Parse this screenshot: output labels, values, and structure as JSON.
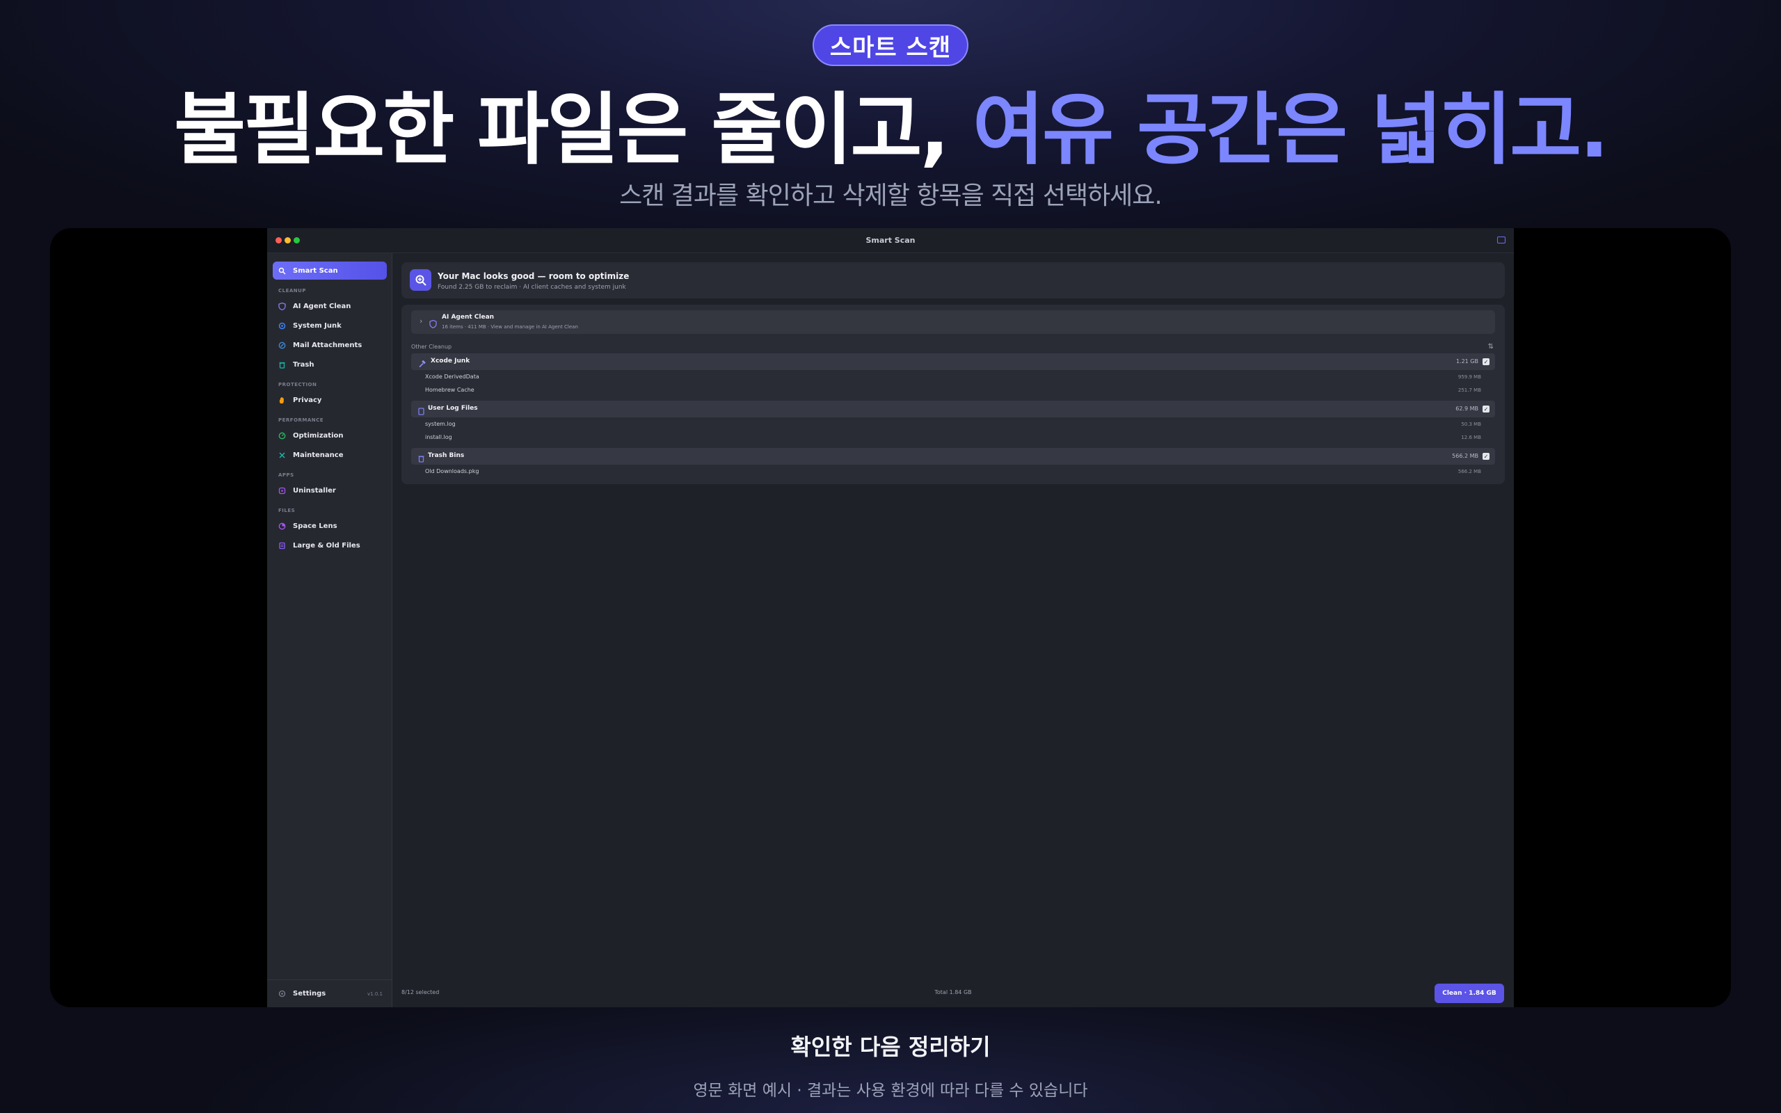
{
  "hero": {
    "badge": "스마트 스캔",
    "title_main": "불필요한 파일은 줄이고, ",
    "title_accent": "여유 공간은 넓히고.",
    "subtitle": "스캔 결과를 확인하고 삭제할 항목을 직접 선택하세요."
  },
  "window": {
    "title": "Smart Scan"
  },
  "sidebar": {
    "smart_scan": "Smart Scan",
    "sections": {
      "cleanup": "CLEANUP",
      "protection": "PROTECTION",
      "performance": "PERFORMANCE",
      "apps": "APPS",
      "files": "FILES"
    },
    "items": {
      "ai_agent_clean": "AI Agent Clean",
      "system_junk": "System Junk",
      "mail_attachments": "Mail Attachments",
      "trash": "Trash",
      "privacy": "Privacy",
      "optimization": "Optimization",
      "maintenance": "Maintenance",
      "uninstaller": "Uninstaller",
      "space_lens": "Space Lens",
      "large_old_files": "Large & Old Files"
    },
    "settings": "Settings",
    "version": "v1.0.1"
  },
  "banner": {
    "title": "Your Mac looks good — room to optimize",
    "subtitle": "Found 2.25 GB to reclaim · AI client caches and system junk"
  },
  "agent_clean": {
    "title": "AI Agent Clean",
    "subtitle": "16 items · 411 MB · View and manage in AI Agent Clean"
  },
  "other_cleanup_label": "Other Cleanup",
  "groups": [
    {
      "label": "Xcode Junk",
      "size": "1.21 GB",
      "checked": "✓",
      "items": [
        {
          "label": "Xcode DerivedData",
          "size": "959.9 MB"
        },
        {
          "label": "Homebrew Cache",
          "size": "251.7 MB"
        }
      ]
    },
    {
      "label": "User Log Files",
      "size": "62.9 MB",
      "checked": "✓",
      "items": [
        {
          "label": "system.log",
          "size": "50.3 MB"
        },
        {
          "label": "install.log",
          "size": "12.6 MB"
        }
      ]
    },
    {
      "label": "Trash Bins",
      "size": "566.2 MB",
      "checked": "✓",
      "items": [
        {
          "label": "Old Downloads.pkg",
          "size": "566.2 MB"
        }
      ]
    }
  ],
  "footer": {
    "selected": "8/12 selected",
    "total": "Total 1.84 GB",
    "clean_button": "Clean · 1.84 GB"
  },
  "bottom": {
    "title": "확인한 다음 정리하기",
    "note": "영문 화면 예시 · 결과는 사용 환경에 따라 다를 수 있습니다"
  },
  "colors": {
    "accent": "#5b54e6",
    "accent_light": "#7c86ff",
    "background": "#1f2129",
    "sidebar": "#262830"
  }
}
